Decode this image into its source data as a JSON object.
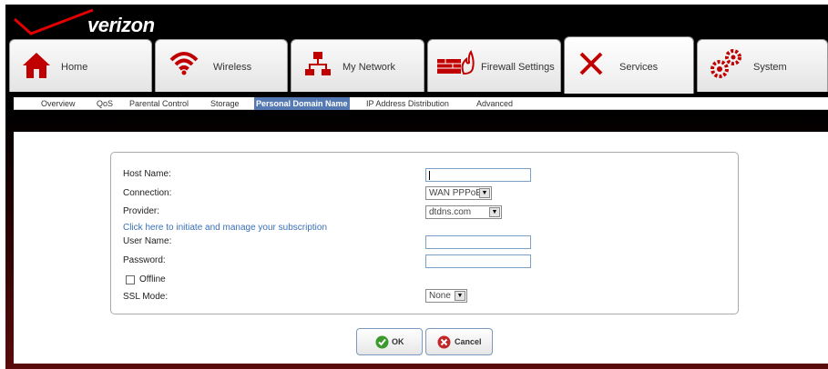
{
  "brand": {
    "name": "verizon"
  },
  "tabs": [
    {
      "label": "Home",
      "icon": "house-icon"
    },
    {
      "label": "Wireless",
      "icon": "wifi-icon"
    },
    {
      "label": "My Network",
      "icon": "network-icon"
    },
    {
      "label": "Firewall Settings",
      "icon": "firewall-icon"
    },
    {
      "label": "Services",
      "icon": "tools-icon",
      "active": true
    },
    {
      "label": "System",
      "icon": "gears-icon"
    }
  ],
  "subnav": [
    {
      "label": "Overview"
    },
    {
      "label": "QoS"
    },
    {
      "label": "Parental Control"
    },
    {
      "label": "Storage"
    },
    {
      "label": "Personal Domain Name",
      "active": true
    },
    {
      "label": "IP Address Distribution"
    },
    {
      "label": "Advanced"
    }
  ],
  "form": {
    "host_name_label": "Host Name:",
    "host_name_value": "",
    "connection_label": "Connection:",
    "connection_value": "WAN PPPoE",
    "provider_label": "Provider:",
    "provider_value": "dtdns.com",
    "subscription_link": "Click here to initiate and manage your subscription",
    "user_name_label": "User Name:",
    "user_name_value": "",
    "password_label": "Password:",
    "password_value": "",
    "offline_label": "Offline",
    "offline_checked": false,
    "ssl_mode_label": "SSL Mode:",
    "ssl_mode_value": "None"
  },
  "buttons": {
    "ok_label": "OK",
    "cancel_label": "Cancel"
  },
  "colors": {
    "accent_red": "#cc0000",
    "link_blue": "#3a70b8",
    "subnav_active": "#5479b3",
    "ok_green": "#3c9a2c",
    "cancel_red": "#c0282a"
  }
}
